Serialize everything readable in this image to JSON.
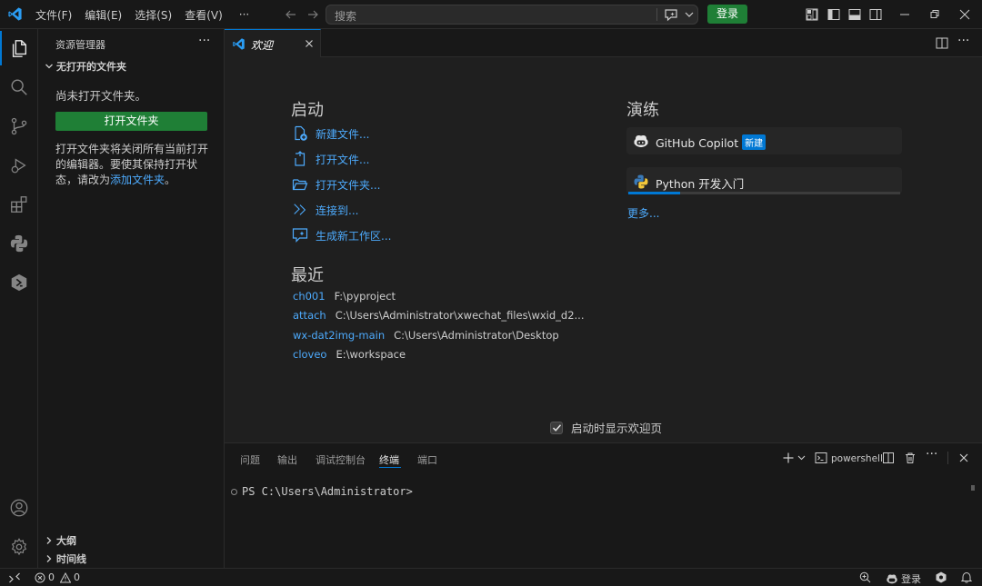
{
  "titlebar": {
    "menu": [
      "文件(F)",
      "编辑(E)",
      "选择(S)",
      "查看(V)",
      "···"
    ],
    "search_placeholder": "搜索",
    "login_label": "登录"
  },
  "sidebar": {
    "title": "资源管理器",
    "more": "···",
    "section_no_folder": "无打开的文件夹",
    "no_folder_msg": "尚未打开文件夹。",
    "open_folder_button": "打开文件夹",
    "desc_text": "打开文件夹将关闭所有当前打开的编辑器。要使其保持打开状态，请改为",
    "desc_link": "添加文件夹",
    "desc_end": "。",
    "section_outline": "大纲",
    "section_timeline": "时间线"
  },
  "tabs": {
    "welcome_label": "欢迎",
    "more": "···"
  },
  "welcome": {
    "start_heading": "启动",
    "start_items": [
      "新建文件...",
      "打开文件...",
      "打开文件夹...",
      "连接到...",
      "生成新工作区..."
    ],
    "recent_heading": "最近",
    "recent": [
      {
        "name": "ch001",
        "path": "F:\\pyproject"
      },
      {
        "name": "attach",
        "path": "C:\\Users\\Administrator\\xwechat_files\\wxid_d2..."
      },
      {
        "name": "wx-dat2img-main",
        "path": "C:\\Users\\Administrator\\Desktop"
      },
      {
        "name": "cloveo",
        "path": "E:\\workspace"
      }
    ],
    "walkthrough_heading": "演练",
    "walkthroughs": [
      {
        "label": "GitHub Copilot",
        "badge": "新建"
      },
      {
        "label": "Python 开发入门",
        "progress": 0.19
      }
    ],
    "more_link": "更多...",
    "show_on_startup": "启动时显示欢迎页",
    "show_on_startup_checked": true
  },
  "panel": {
    "tabs": [
      "问题",
      "输出",
      "调试控制台",
      "终端",
      "端口"
    ],
    "active_tab": "终端",
    "shell_label": "powershell",
    "more": "···",
    "prompt": "PS C:\\Users\\Administrator>"
  },
  "statusbar": {
    "errors": "0",
    "warnings": "0",
    "login": "登录"
  },
  "colors": {
    "accent": "#0078d4",
    "link": "#4daafc",
    "button_green": "#1f7f36"
  }
}
